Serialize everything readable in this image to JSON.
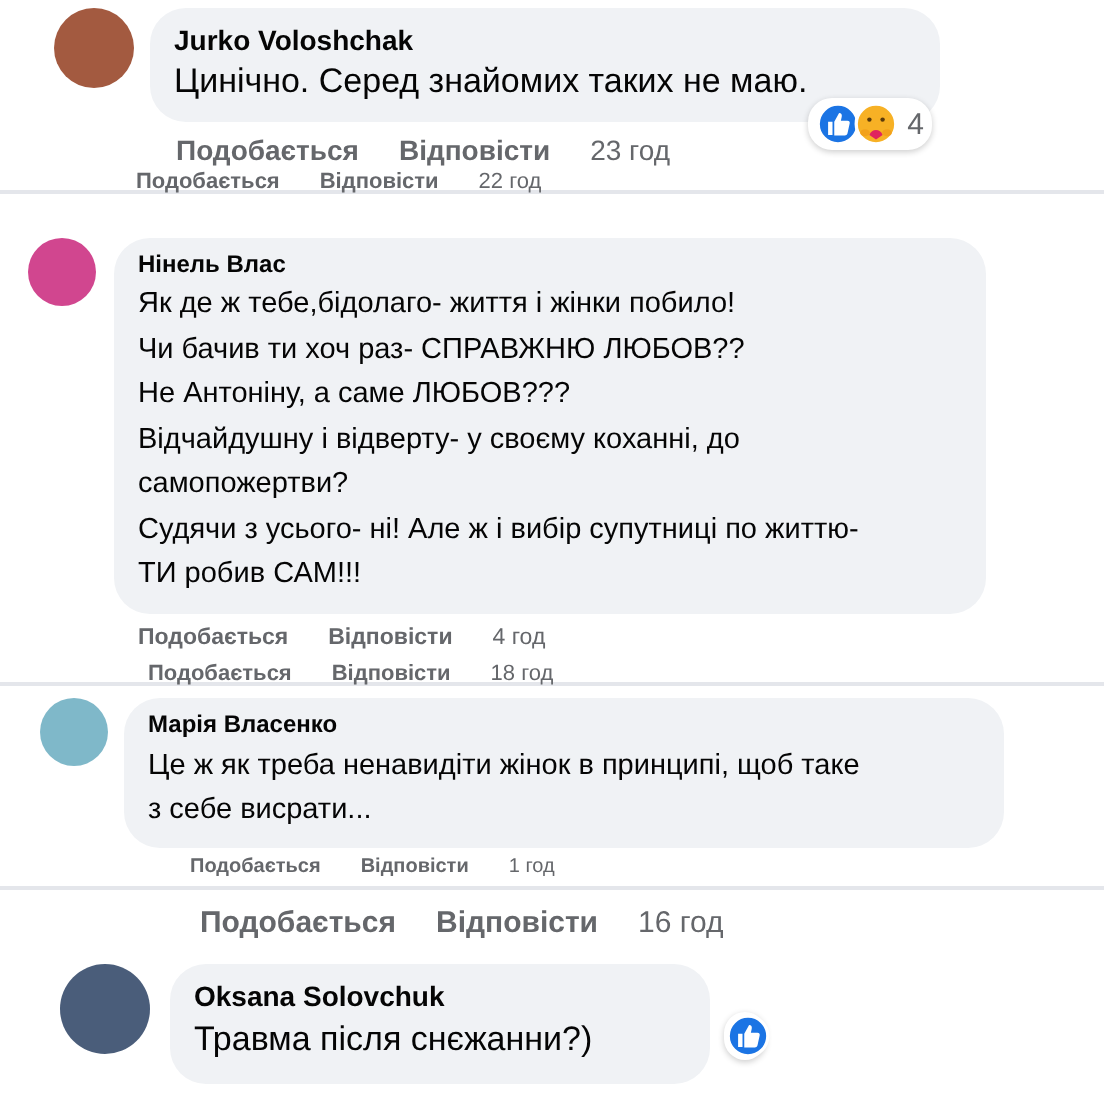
{
  "panels": [
    {
      "items": [
        {
          "kind": "comment",
          "author": "Jurko Voloshchak",
          "lines": [
            "Цинічно. Серед знайомих таких не маю."
          ],
          "reactions": {
            "items": [
              {
                "kind": "like"
              },
              {
                "kind": "care"
              }
            ],
            "count": "4"
          }
        },
        {
          "kind": "actions",
          "like": "Подобається",
          "reply": "Відповісти",
          "time": "23 год"
        },
        {
          "kind": "cut_actions",
          "like": "Подобається",
          "reply": "Відповісти",
          "time": "22 год"
        }
      ]
    },
    {
      "items": [
        {
          "kind": "comment",
          "author": "Нінель Влас",
          "lines": [
            "Як де ж тебе,бідолаго- життя і жінки побило!",
            "Чи бачив ти хоч раз- СПРАВЖНЮ ЛЮБОВ??",
            "Не Антоніну, а саме ЛЮБОВ???",
            "Відчайдушну і відверту- у своєму коханні, до",
            "самопожертви?",
            "Судячи з усього- ні! Але ж і вибір супутниці по життю-",
            "ТИ робив САМ!!!"
          ]
        },
        {
          "kind": "actions",
          "like": "Подобається",
          "reply": "Відповісти",
          "time": "4 год"
        },
        {
          "kind": "cut_actions",
          "like": "Подобається",
          "reply": "Відповісти",
          "time": "18 год"
        }
      ]
    },
    {
      "items": [
        {
          "kind": "comment",
          "author": "Марія Власенко",
          "lines": [
            "Це ж як треба ненавидіти жінок в принципі, щоб таке",
            "з себе висрати..."
          ]
        },
        {
          "kind": "cut_actions",
          "like": "Подобається",
          "reply": "Відповісти",
          "time": "1 год"
        }
      ]
    },
    {
      "items": [
        {
          "kind": "actions",
          "like": "Подобається",
          "reply": "Відповісти",
          "time": "16 год"
        },
        {
          "kind": "comment",
          "author": "Oksana Solovchuk",
          "lines": [
            "Травма після снєжанни?)"
          ],
          "reactions": {
            "items": [
              {
                "kind": "like"
              }
            ]
          }
        }
      ]
    }
  ]
}
